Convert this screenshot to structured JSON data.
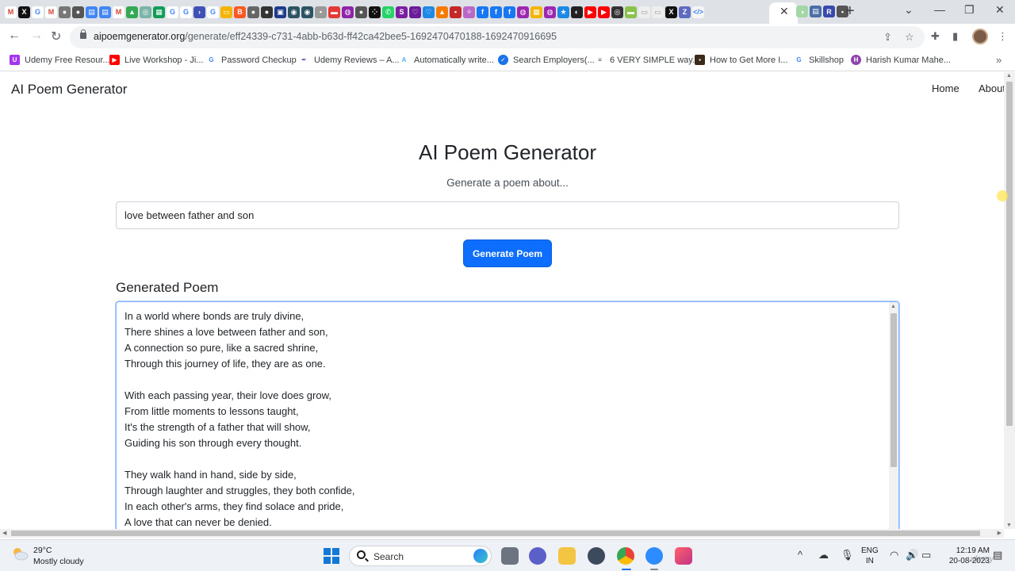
{
  "browser": {
    "url_domain": "aipoemgenerator.org",
    "url_path": "/generate/eff24339-c731-4abb-b63d-ff42ca42bee5-1692470470188-1692470916695",
    "tab_close": "✕",
    "new_tab": "+",
    "bookmarks": [
      {
        "label": "Udemy Free Resour...",
        "icon": "udemy-icon",
        "color": "#a435f0"
      },
      {
        "label": "Live Workshop - Ji...",
        "icon": "youtube-icon",
        "color": "#ff0000"
      },
      {
        "label": "Password Checkup",
        "icon": "google-icon",
        "color": "#4285f4"
      },
      {
        "label": "Udemy Reviews – A...",
        "icon": "feather-icon",
        "color": "#6b4fbb"
      },
      {
        "label": "Automatically write...",
        "icon": "ai-writer-icon",
        "color": "#5ab0f5"
      },
      {
        "label": "Search Employers(...",
        "icon": "globe-icon",
        "color": "#1a73e8"
      },
      {
        "label": "6 VERY SIMPLE way...",
        "icon": "site-icon",
        "color": "#444444"
      },
      {
        "label": "How to Get More I...",
        "icon": "photo-icon",
        "color": "#3b2a1a"
      },
      {
        "label": "Skillshop",
        "icon": "google-icon",
        "color": "#4285f4"
      },
      {
        "label": "Harish Kumar Mahe...",
        "icon": "profile-icon",
        "color": "#8e44ad"
      }
    ]
  },
  "site": {
    "brand": "AI Poem Generator",
    "nav": {
      "home": "Home",
      "about": "About"
    }
  },
  "main": {
    "title": "AI Poem Generator",
    "subtitle": "Generate a poem about...",
    "topic_value": "love between father and son",
    "generate_label": "Generate Poem",
    "result_heading": "Generated Poem",
    "poem_lines": [
      "In a world where bonds are truly divine,",
      "There shines a love between father and son,",
      "A connection so pure, like a sacred shrine,",
      "Through this journey of life, they are as one.",
      "",
      "With each passing year, their love does grow,",
      "From little moments to lessons taught,",
      "It's the strength of a father that will show,",
      "Guiding his son through every thought.",
      "",
      "They walk hand in hand, side by side,",
      "Through laughter and struggles, they both confide,",
      "In each other's arms, they find solace and pride,",
      "A love that can never be denied."
    ]
  },
  "taskbar": {
    "weather_temp": "29°C",
    "weather_desc": "Mostly cloudy",
    "search_label": "Search",
    "lang_line1": "ENG",
    "lang_line2": "IN",
    "time": "12:19 AM",
    "date": "20-08-2023",
    "watermark": "udemy"
  }
}
